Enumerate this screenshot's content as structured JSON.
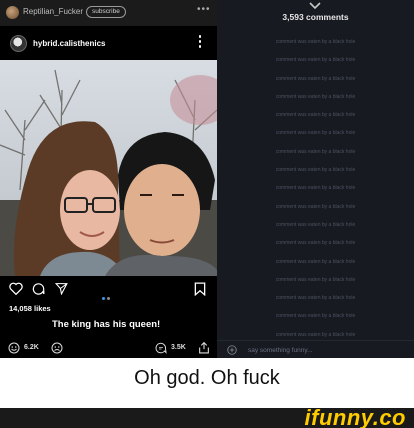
{
  "topbar": {
    "username": "Reptilian_Fucker",
    "subscribe_label": "subscribe",
    "more_glyph": "•••"
  },
  "post": {
    "username": "hybrid.calisthenics",
    "likes": "14,058 likes",
    "caption": "The king has his queen!",
    "photo_description_icons": [
      "heart-icon",
      "comment-icon",
      "share-icon",
      "bookmark-icon"
    ]
  },
  "stats": {
    "smiles": "6.2K",
    "comments": "3.5K"
  },
  "comments_panel": {
    "count_label": "3,593 comments",
    "placeholder_text": "comment was eaten by a black hole",
    "items": [
      "comment was eaten by a black hole",
      "comment was eaten by a black hole",
      "comment was eaten by a black hole",
      "comment was eaten by a black hole",
      "comment was eaten by a black hole",
      "comment was eaten by a black hole",
      "comment was eaten by a black hole",
      "comment was eaten by a black hole",
      "comment was eaten by a black hole",
      "comment was eaten by a black hole",
      "comment was eaten by a black hole",
      "comment was eaten by a black hole",
      "comment was eaten by a black hole",
      "comment was eaten by a black hole",
      "comment was eaten by a black hole",
      "comment was eaten by a black hole",
      "comment was eaten by a black hole"
    ],
    "reply_placeholder": "say something funny..."
  },
  "meme_caption": "Oh god. Oh fuck",
  "watermark": "ifunny.co",
  "colors": {
    "accent_yellow": "#ffcc00",
    "panel_bg": "#171a21",
    "dot_blue": "#3897f0"
  }
}
